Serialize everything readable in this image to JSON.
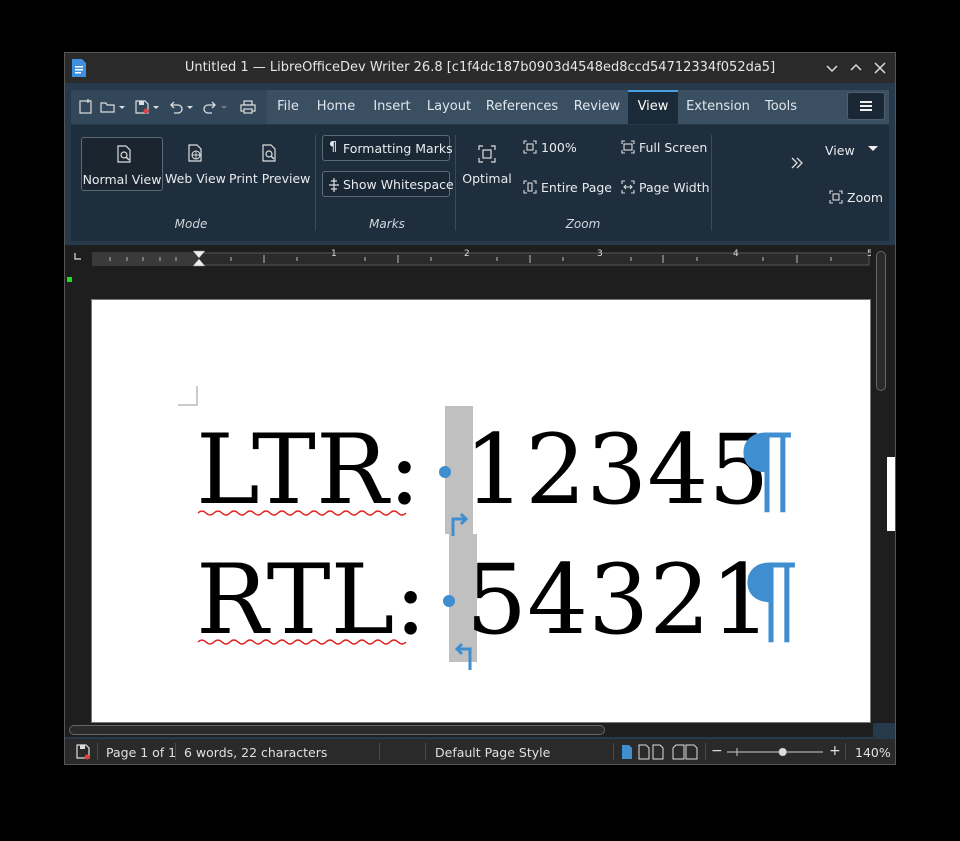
{
  "window": {
    "title": "Untitled 1 — LibreOfficeDev Writer 26.8 [c1f4dc187b0903d4548ed8ccd54712334f052da5]"
  },
  "tabs": [
    {
      "label": "File"
    },
    {
      "label": "Home"
    },
    {
      "label": "Insert"
    },
    {
      "label": "Layout"
    },
    {
      "label": "References"
    },
    {
      "label": "Review"
    },
    {
      "label": "View"
    },
    {
      "label": "Extension"
    },
    {
      "label": "Tools"
    }
  ],
  "active_tab": "View",
  "ribbon": {
    "mode": {
      "label": "Mode",
      "normal_view": "Normal View",
      "web_view": "Web View",
      "print_preview": "Print Preview"
    },
    "marks": {
      "label": "Marks",
      "formatting_marks": "Formatting Marks",
      "show_whitespace": "Show Whitespace"
    },
    "zoom": {
      "label": "Zoom",
      "optimal": "Optimal",
      "zoom_100": "100%",
      "entire_page": "Entire Page",
      "full_screen": "Full Screen",
      "page_width": "Page Width"
    },
    "overflow": {
      "view_dropdown": "View",
      "zoom_button": "Zoom"
    }
  },
  "ruler": {
    "labels": [
      "1",
      "2",
      "3",
      "4",
      "5"
    ]
  },
  "document": {
    "line1_label": "LTR:",
    "line1_number": "12345",
    "line2_label": "RTL:",
    "line2_number": "54321",
    "pilcrow": "¶"
  },
  "statusbar": {
    "page": "Page 1 of 1",
    "word_count": "6 words, 22 characters",
    "page_style": "Default Page Style",
    "zoom": "140%",
    "zoom_level": 0.58
  },
  "colors": {
    "accent": "#3e8ed0",
    "titlebar": "#2a2a2a",
    "ribbon": "#1f2e3d",
    "spellcheck": "#e02020",
    "field_shading": "#c0c0c0"
  }
}
